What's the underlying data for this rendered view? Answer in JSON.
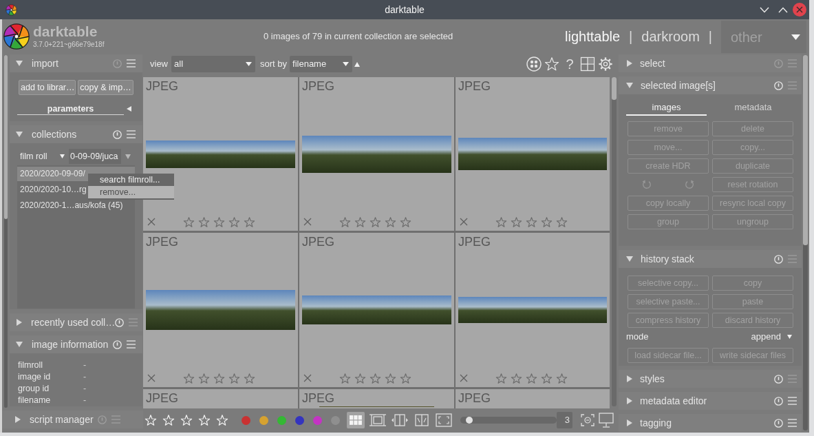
{
  "window": {
    "title": "darktable"
  },
  "header": {
    "app_name": "darktable",
    "version": "3.7.0+221~g66e79e18f",
    "status": "0 images of 79 in current collection are selected",
    "views": [
      {
        "label": "lighttable",
        "selected": true
      },
      {
        "label": "darkroom",
        "selected": false
      }
    ],
    "separators": [
      "|",
      "|"
    ],
    "other_view": {
      "label": "other"
    }
  },
  "left_panel": {
    "modules": [
      {
        "kind": "import",
        "title": "import",
        "expanded": true,
        "reset_disabled": true,
        "presets_disabled": false,
        "buttons": [
          {
            "label": "add to librar…",
            "disabled": false
          },
          {
            "label": "copy & imp…",
            "disabled": false
          }
        ],
        "section": {
          "label": "parameters",
          "expanded": false
        }
      },
      {
        "kind": "collections",
        "title": "collections",
        "expanded": true,
        "reset_disabled": false,
        "presets_disabled": false,
        "property": "film roll",
        "query": "0-09-09/juca",
        "items": [
          {
            "label": "2020/2020-09-09/",
            "selected": true
          },
          {
            "label": "2020/2020-10…rg",
            "selected": false
          },
          {
            "label": "2020/2020-1…aus/kofa (45)",
            "selected": false
          }
        ]
      },
      {
        "kind": "plain",
        "title": "recently used coll…",
        "expanded": false,
        "reset_disabled": false,
        "presets_disabled": true
      },
      {
        "kind": "info",
        "title": "image information",
        "expanded": true,
        "reset_disabled": false,
        "presets_disabled": false,
        "fields": [
          {
            "label": "filmroll",
            "value": "-"
          },
          {
            "label": "image id",
            "value": "-"
          },
          {
            "label": "group id",
            "value": "-"
          },
          {
            "label": "filename",
            "value": "-"
          }
        ]
      }
    ],
    "bottom_module": {
      "kind": "plain",
      "title": "script manager",
      "expanded": false,
      "reset_disabled": true,
      "presets_disabled": true
    }
  },
  "collection_menu": {
    "items": [
      {
        "label": "search filmroll...",
        "selected": true
      },
      {
        "label": "remove...",
        "selected": false
      }
    ]
  },
  "top_toolbar": {
    "view_label": "view",
    "view_value": "all",
    "sort_label": "sort by",
    "sort_value": "filename",
    "help": "?"
  },
  "thumbnails": [
    {
      "label": "JPEG",
      "photo": true,
      "stars": 0
    },
    {
      "label": "JPEG",
      "photo": true,
      "stars": 0
    },
    {
      "label": "JPEG",
      "photo": true,
      "stars": 0
    },
    {
      "label": "JPEG",
      "photo": true,
      "stars": 0
    },
    {
      "label": "JPEG",
      "photo": true,
      "stars": 0
    },
    {
      "label": "JPEG",
      "photo": true,
      "stars": 0
    },
    {
      "label": "JPEG",
      "photo": false
    },
    {
      "label": "JPEG",
      "photo": true
    },
    {
      "label": "JPEG",
      "photo": false
    }
  ],
  "bottom_toolbar": {
    "color_labels": [
      {
        "color": "#c93232"
      },
      {
        "color": "#d6a230"
      },
      {
        "color": "#34b834"
      },
      {
        "color": "#3434be"
      },
      {
        "color": "#c434c4"
      },
      {
        "color": "#8f8f8f"
      }
    ],
    "layouts": [
      {
        "kind": "grid",
        "selected": true
      },
      {
        "kind": "culling",
        "selected": false
      },
      {
        "kind": "compare_dynamic",
        "selected": false
      },
      {
        "kind": "compare",
        "selected": false
      },
      {
        "kind": "preview",
        "selected": false
      }
    ],
    "zoom": {
      "level": 0.06,
      "value": "3"
    }
  },
  "right_panel": {
    "modules": [
      {
        "kind": "plain",
        "title": "select",
        "expanded": false,
        "reset_disabled": true,
        "presets_disabled": true
      },
      {
        "kind": "selected_images",
        "title": "selected image[s]",
        "expanded": true,
        "reset_disabled": false,
        "presets_disabled": true,
        "tabs": [
          {
            "label": "images",
            "selected": true
          },
          {
            "label": "metadata",
            "selected": false
          }
        ],
        "actions": [
          {
            "kind": "button",
            "label": "remove",
            "disabled": true
          },
          {
            "kind": "button",
            "label": "delete",
            "disabled": true
          },
          {
            "kind": "button",
            "label": "move...",
            "disabled": true
          },
          {
            "kind": "button",
            "label": "copy...",
            "disabled": true
          },
          {
            "kind": "button",
            "label": "create HDR",
            "disabled": true
          },
          {
            "kind": "button",
            "label": "duplicate",
            "disabled": true
          },
          {
            "kind": "rotate",
            "disabled": true
          },
          {
            "kind": "button",
            "label": "reset rotation",
            "disabled": true
          },
          {
            "kind": "button",
            "label": "copy locally",
            "disabled": true
          },
          {
            "kind": "button",
            "label": "resync local copy",
            "disabled": true
          },
          {
            "kind": "button",
            "label": "group",
            "disabled": true
          },
          {
            "kind": "button",
            "label": "ungroup",
            "disabled": true
          }
        ]
      },
      {
        "kind": "history",
        "title": "history stack",
        "expanded": true,
        "reset_disabled": false,
        "presets_disabled": true,
        "actions": [
          {
            "kind": "button",
            "label": "selective copy...",
            "disabled": true
          },
          {
            "kind": "button",
            "label": "copy",
            "disabled": true
          },
          {
            "kind": "button",
            "label": "selective paste...",
            "disabled": true
          },
          {
            "kind": "button",
            "label": "paste",
            "disabled": true
          },
          {
            "kind": "button",
            "label": "compress history",
            "disabled": true
          },
          {
            "kind": "button",
            "label": "discard history",
            "disabled": true
          }
        ],
        "mode": {
          "label": "mode",
          "value": "append"
        },
        "sidecar_actions": [
          {
            "kind": "button",
            "label": "load sidecar file...",
            "disabled": true
          },
          {
            "kind": "button",
            "label": "write sidecar files",
            "disabled": true
          }
        ]
      },
      {
        "kind": "plain",
        "title": "styles",
        "expanded": false,
        "reset_disabled": false,
        "presets_disabled": true
      },
      {
        "kind": "plain",
        "title": "metadata editor",
        "expanded": false,
        "reset_disabled": false,
        "presets_disabled": false
      },
      {
        "kind": "plain",
        "title": "tagging",
        "expanded": false,
        "reset_disabled": false,
        "presets_disabled": false
      }
    ]
  }
}
